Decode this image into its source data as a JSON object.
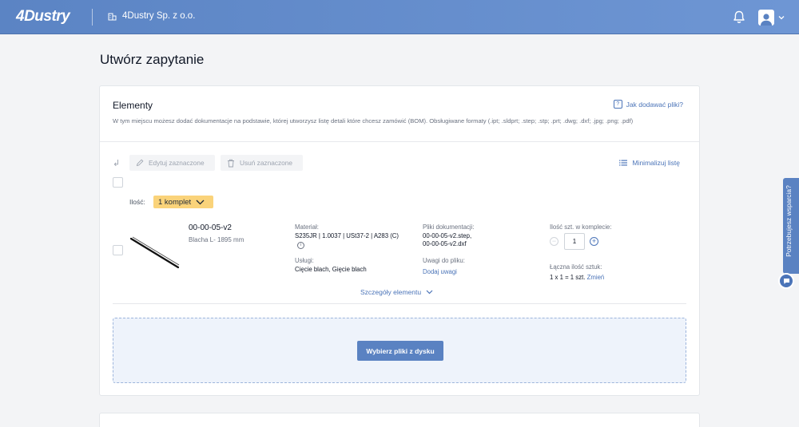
{
  "header": {
    "logo": "4Dustry",
    "company": "4Dustry Sp. z o.o."
  },
  "page": {
    "title": "Utwórz zapytanie"
  },
  "elements": {
    "title": "Elementy",
    "help_link": "Jak dodawać pliki?",
    "description": "W tym miejscu możesz dodać dokumentacje na podstawie, której utworzysz listę detali które chcesz zamówić (BOM). Obsługiwane formaty (.ipt; .sldprt; .step; .stp; .prt; .dwg; .dxf; .jpg; .png; .pdf)",
    "toolbar": {
      "edit_label": "Edytuj zaznaczone",
      "delete_label": "Usuń zaznaczone",
      "minimize_label": "Minimalizuj listę"
    },
    "quantity": {
      "label": "Ilość:",
      "value": "1 komplet"
    },
    "part": {
      "name": "00-00-05-v2",
      "subtitle": "Blacha L- 1895 mm",
      "material_label": "Materiał:",
      "material_value": "S235JR | 1.0037 | USt37-2 | A283 (C)",
      "services_label": "Usługi:",
      "services_value": "Cięcie blach, Gięcie blach",
      "files_label": "Pliki dokumentacji:",
      "files": [
        "00-00-05-v2.step,",
        "00-00-05-v2.dxf"
      ],
      "notes_label": "Uwagi do pliku:",
      "notes_link": "Dodaj uwagi",
      "qty_label": "Ilość szt. w komplecie:",
      "qty_value": "1",
      "total_label": "Łączna ilość sztuk:",
      "total_prefix": "1 x 1 = ",
      "total_value": "1 szt.",
      "total_change": "Zmień",
      "details_link": "Szczegóły elementu"
    },
    "upload_button": "Wybierz pliki z dysku"
  },
  "support": {
    "label": "Potrzebujesz wsparcia?"
  },
  "colors": {
    "accent": "#5a82c2",
    "badge": "#fad37a"
  }
}
